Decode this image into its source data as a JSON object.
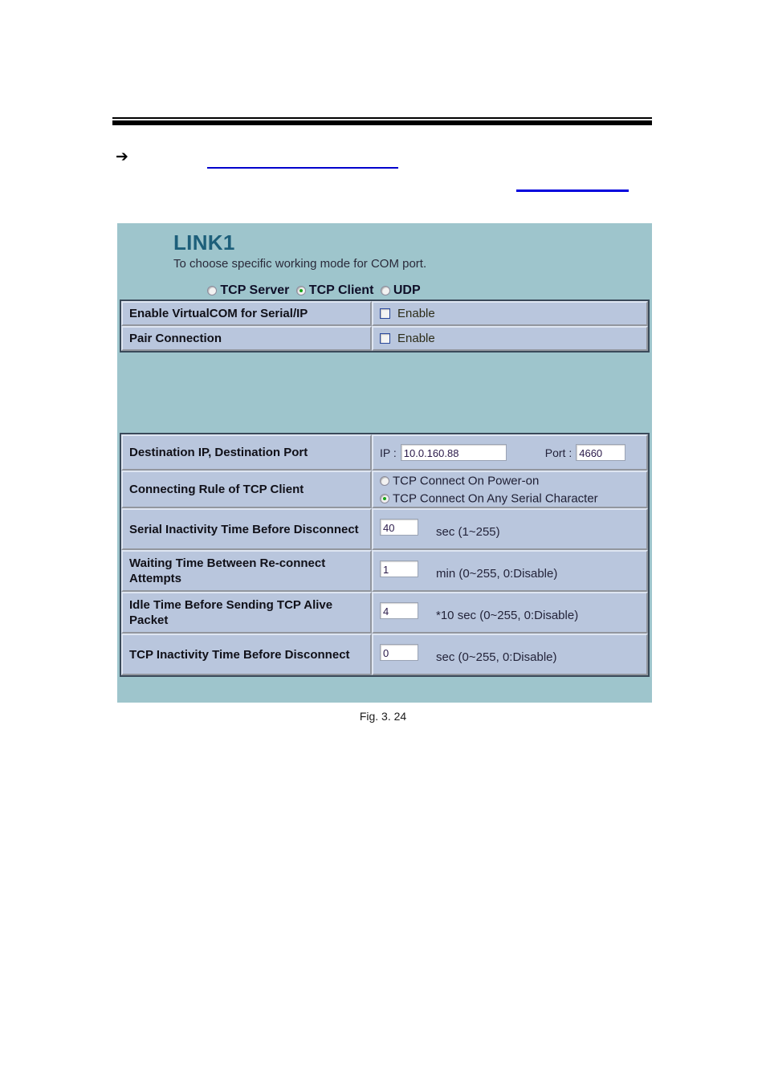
{
  "document": {
    "bullet_glyph": "➔",
    "caption": "Fig. 3. 24",
    "link_color": "#0000cc",
    "rule_color": "#000000"
  },
  "panel": {
    "title": "LINK1",
    "subtitle": "To choose specific working mode for COM port.",
    "background_color": "#9ec5cc",
    "title_color": "#1d5f7a",
    "mode_options": [
      {
        "label": "TCP Server",
        "selected": false
      },
      {
        "label": "TCP Client",
        "selected": true
      },
      {
        "label": "UDP",
        "selected": false
      }
    ],
    "selected_mode": "TCP Client",
    "selected_indicator_color": "#18a518"
  },
  "settings_top": {
    "rows": [
      {
        "label": "Enable VirtualCOM for Serial/IP",
        "checkbox_label": "Enable",
        "checked": false
      },
      {
        "label": "Pair Connection",
        "checkbox_label": "Enable",
        "checked": false
      }
    ]
  },
  "settings_bottom": {
    "destination": {
      "label": "Destination IP, Destination Port",
      "ip_tag": "IP :",
      "ip_value": "10.0.160.88",
      "port_tag": "Port :",
      "port_value": "4660"
    },
    "connecting_rule": {
      "label": "Connecting Rule of TCP Client",
      "options": [
        {
          "label": "TCP Connect On Power-on",
          "selected": false
        },
        {
          "label": "TCP Connect On Any Serial Character",
          "selected": true
        }
      ]
    },
    "serial_inactivity": {
      "label": "Serial Inactivity Time Before Disconnect",
      "value": "40",
      "unit": "sec (1~255)"
    },
    "reconnect_wait": {
      "label": "Waiting Time Between Re-connect Attempts",
      "value": "1",
      "unit": "min (0~255, 0:Disable)"
    },
    "tcp_alive_idle": {
      "label": "Idle Time Before Sending TCP Alive Packet",
      "value": "4",
      "unit": "*10 sec (0~255, 0:Disable)"
    },
    "tcp_inactivity": {
      "label": "TCP Inactivity Time Before Disconnect",
      "value": "0",
      "unit": "sec (0~255, 0:Disable)"
    }
  }
}
